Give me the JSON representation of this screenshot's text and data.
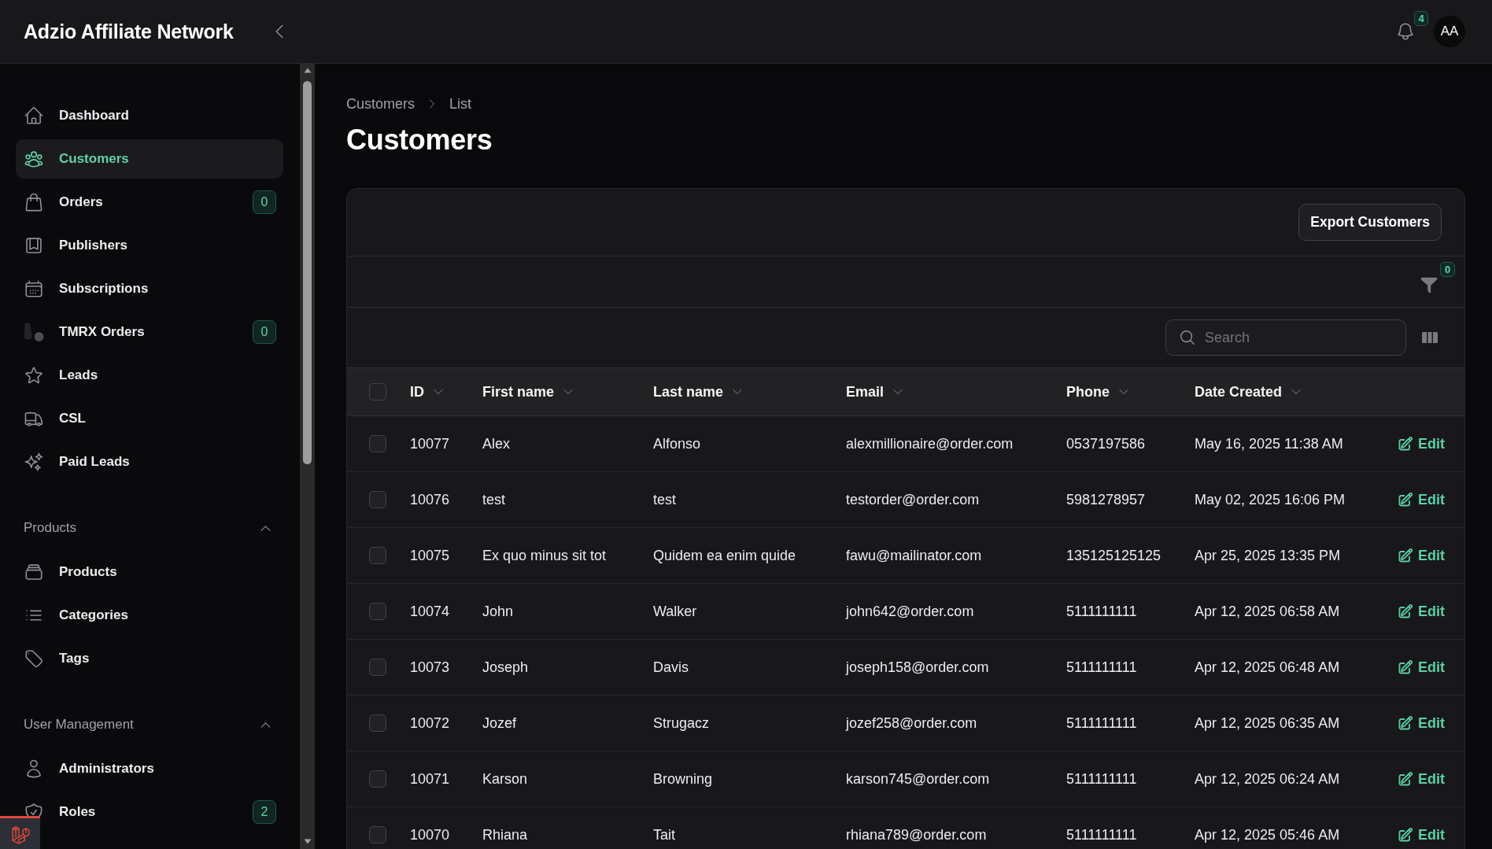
{
  "app_title": "Adzio Affiliate Network",
  "topbar": {
    "notifications_count": "4",
    "avatar_initials": "AA"
  },
  "sidebar": {
    "items": [
      {
        "label": "Dashboard",
        "selected": false
      },
      {
        "label": "Customers",
        "selected": true
      },
      {
        "label": "Orders",
        "selected": false,
        "badge": "0"
      },
      {
        "label": "Publishers",
        "selected": false
      },
      {
        "label": "Subscriptions",
        "selected": false
      },
      {
        "label": "TMRX Orders",
        "selected": false,
        "badge": "0"
      },
      {
        "label": "Leads",
        "selected": false
      },
      {
        "label": "CSL",
        "selected": false
      },
      {
        "label": "Paid Leads",
        "selected": false
      }
    ],
    "groups": [
      {
        "label": "Products",
        "expanded": true,
        "items": [
          {
            "label": "Products",
            "selected": false
          },
          {
            "label": "Categories",
            "selected": false
          },
          {
            "label": "Tags",
            "selected": false
          }
        ]
      },
      {
        "label": "User Management",
        "expanded": true,
        "items": [
          {
            "label": "Administrators",
            "selected": false
          },
          {
            "label": "Roles",
            "selected": false,
            "badge": "2"
          }
        ]
      }
    ]
  },
  "breadcrumbs": [
    "Customers",
    "List"
  ],
  "page_title": "Customers",
  "table": {
    "export_button": "Export Customers",
    "filter_count": "0",
    "search": {
      "placeholder": "Search"
    },
    "all_selected": false,
    "columns": [
      "ID",
      "First name",
      "Last name",
      "Email",
      "Phone",
      "Date Created"
    ],
    "rows": [
      {
        "selected": false,
        "cells": [
          "10077",
          "Alex",
          "Alfonso",
          "alexmillionaire@order.com",
          "0537197586",
          "May 16, 2025 11:38 AM"
        ],
        "action": "Edit"
      },
      {
        "selected": false,
        "cells": [
          "10076",
          "test",
          "test",
          "testorder@order.com",
          "5981278957",
          "May 02, 2025 16:06 PM"
        ],
        "action": "Edit"
      },
      {
        "selected": false,
        "cells": [
          "10075",
          "Ex quo minus sit tot",
          "Quidem ea enim quide",
          "fawu@mailinator.com",
          "135125125125",
          "Apr 25, 2025 13:35 PM"
        ],
        "action": "Edit"
      },
      {
        "selected": false,
        "cells": [
          "10074",
          "John",
          "Walker",
          "john642@order.com",
          "5111111111",
          "Apr 12, 2025 06:58 AM"
        ],
        "action": "Edit"
      },
      {
        "selected": false,
        "cells": [
          "10073",
          "Joseph",
          "Davis",
          "joseph158@order.com",
          "5111111111",
          "Apr 12, 2025 06:48 AM"
        ],
        "action": "Edit"
      },
      {
        "selected": false,
        "cells": [
          "10072",
          "Jozef",
          "Strugacz",
          "jozef258@order.com",
          "5111111111",
          "Apr 12, 2025 06:35 AM"
        ],
        "action": "Edit"
      },
      {
        "selected": false,
        "cells": [
          "10071",
          "Karson",
          "Browning",
          "karson745@order.com",
          "5111111111",
          "Apr 12, 2025 06:24 AM"
        ],
        "action": "Edit"
      },
      {
        "selected": false,
        "cells": [
          "10070",
          "Rhiana",
          "Tait",
          "rhiana789@order.com",
          "5111111111",
          "Apr 12, 2025 05:46 AM"
        ],
        "action": "Edit"
      }
    ]
  }
}
